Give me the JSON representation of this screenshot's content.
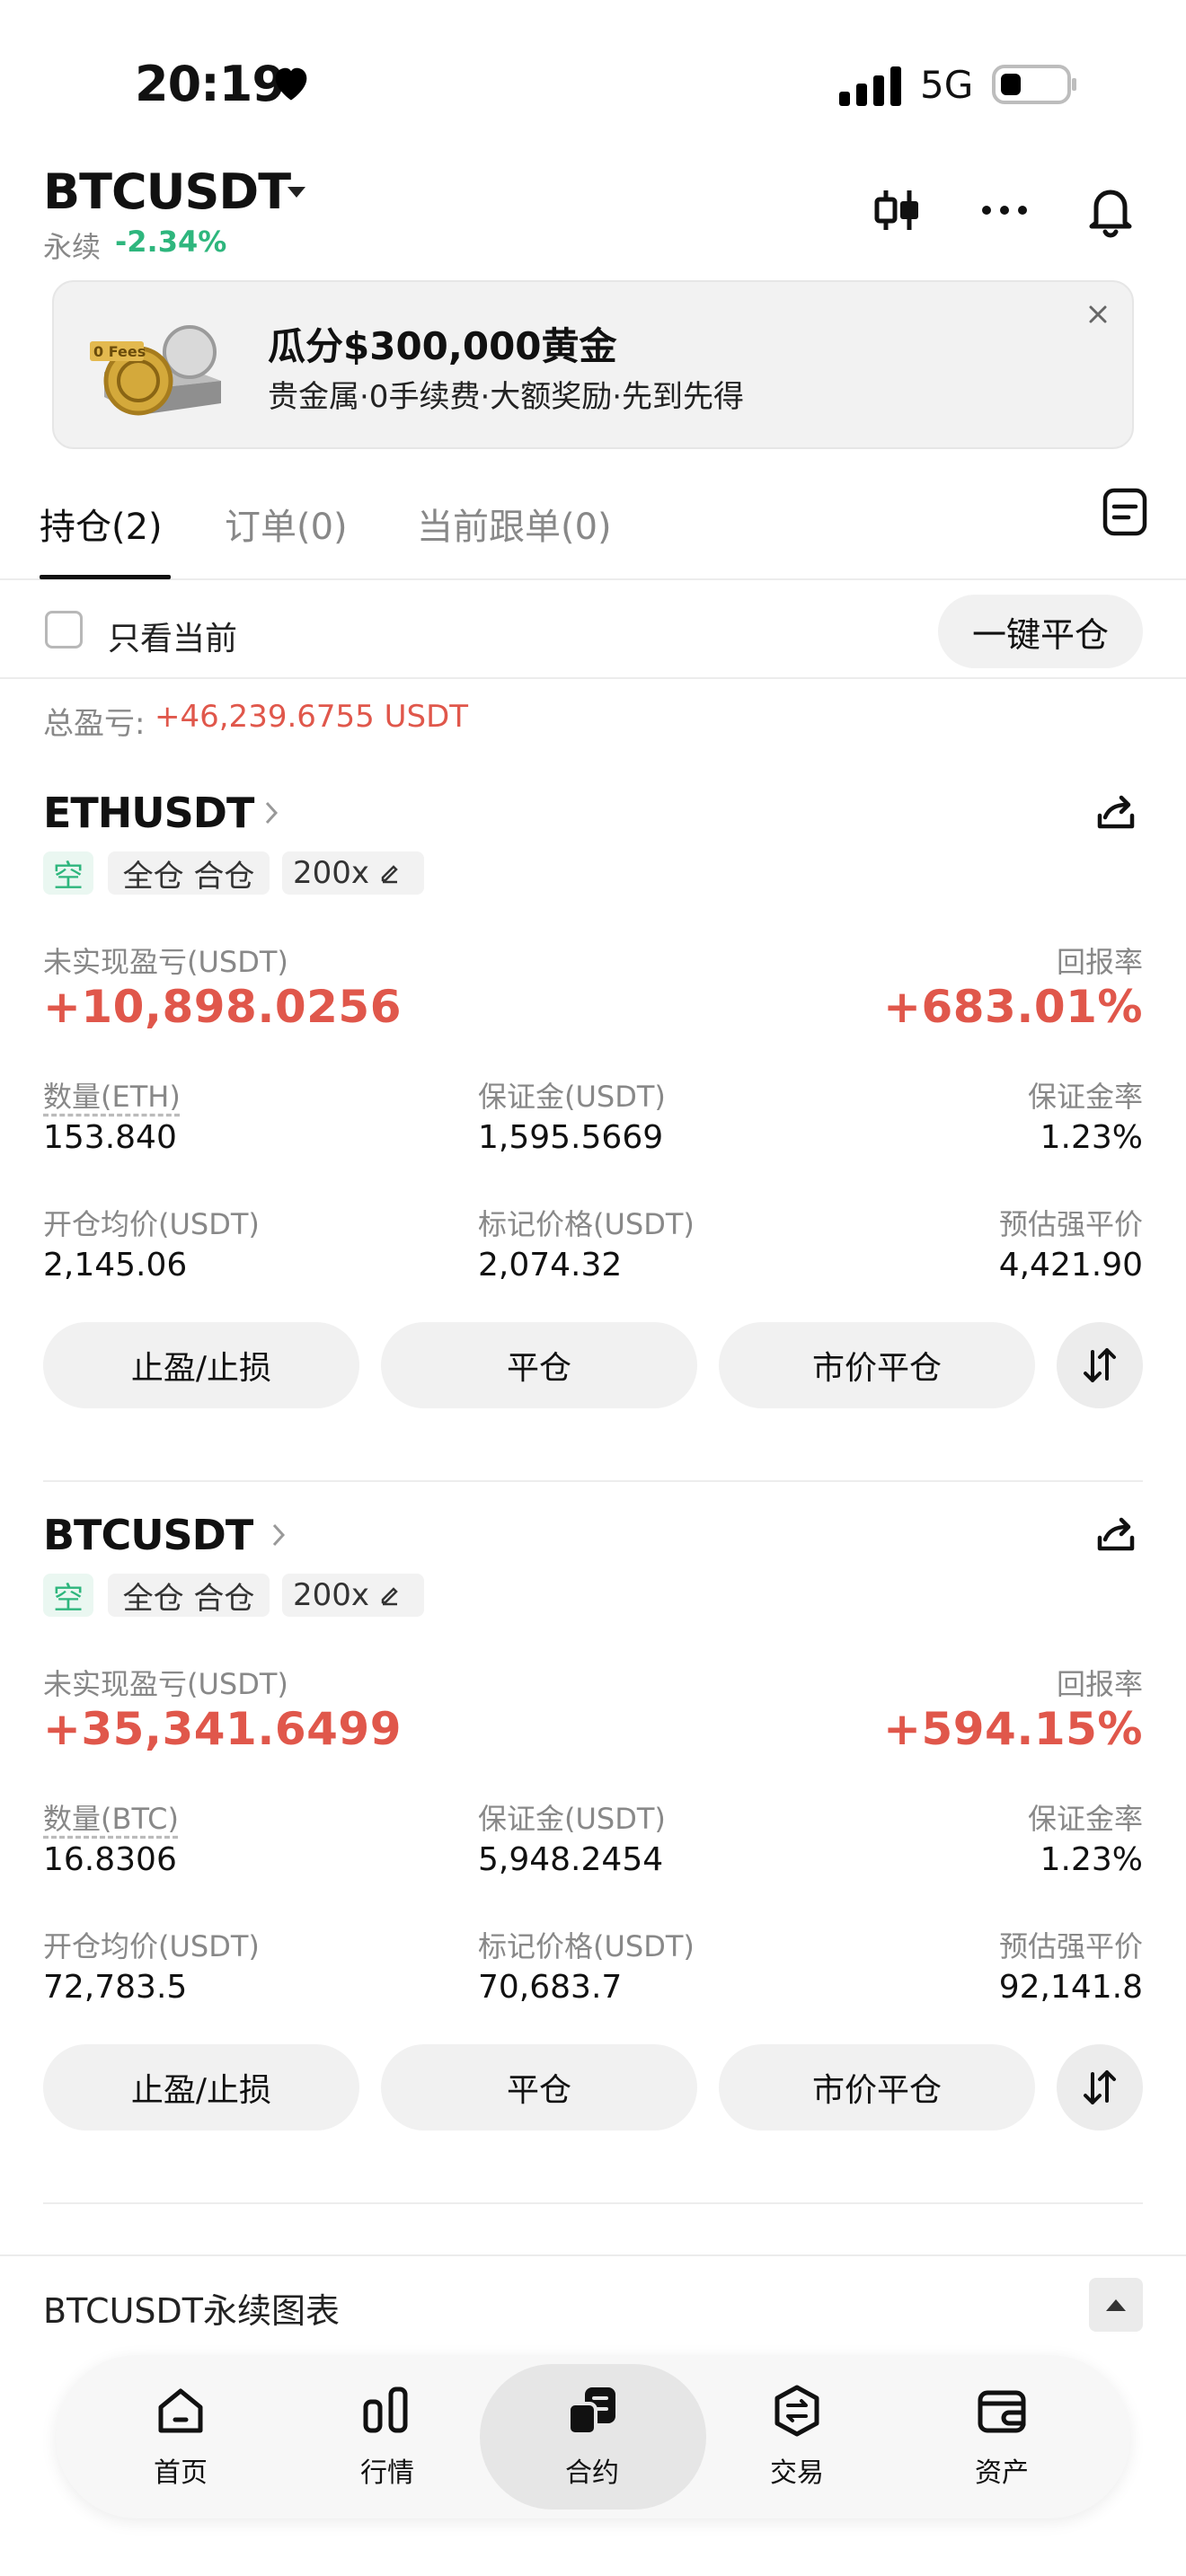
{
  "status_bar": {
    "time": "20:19",
    "network": "5G"
  },
  "header": {
    "pair": "BTCUSDT",
    "contract_type": "永续",
    "change": "-2.34%",
    "icons": [
      "candlestick-icon",
      "more-icon",
      "bell-icon"
    ]
  },
  "banner": {
    "title": "瓜分$300,000黄金",
    "subtitle": "贵金属·0手续费·大额奖励·先到先得",
    "image_text": "0 Fees"
  },
  "tabs": [
    {
      "label": "持仓(2)",
      "active": true
    },
    {
      "label": "订单(0)",
      "active": false
    },
    {
      "label": "当前跟单(0)",
      "active": false
    }
  ],
  "filter": {
    "only_current": "只看当前",
    "close_all": "一键平仓"
  },
  "summary": {
    "total_pnl_label": "总盈亏:",
    "total_pnl_value": "+46,239.6755 USDT"
  },
  "labels": {
    "unrealized_pnl": "未实现盈亏(USDT)",
    "roe": "回报率",
    "margin": "保证金(USDT)",
    "margin_ratio": "保证金率",
    "entry_price": "开仓均价(USDT)",
    "mark_price": "标记价格(USDT)",
    "liq_price": "预估强平价",
    "tp_sl": "止盈/止损",
    "close": "平仓",
    "market_close": "市价平仓"
  },
  "positions": [
    {
      "symbol": "ETHUSDT",
      "side": "空",
      "mode": "全仓 合仓",
      "leverage": "200x",
      "unrealized_pnl": "+10,898.0256",
      "roe": "+683.01%",
      "qty_label": "数量(ETH)",
      "qty": "153.840",
      "margin": "1,595.5669",
      "margin_ratio": "1.23%",
      "entry_price": "2,145.06",
      "mark_price": "2,074.32",
      "liq_price": "4,421.90"
    },
    {
      "symbol": "BTCUSDT",
      "side": "空",
      "mode": "全仓 合仓",
      "leverage": "200x",
      "unrealized_pnl": "+35,341.6499",
      "roe": "+594.15%",
      "qty_label": "数量(BTC)",
      "qty": "16.8306",
      "margin": "5,948.2454",
      "margin_ratio": "1.23%",
      "entry_price": "72,783.5",
      "mark_price": "70,683.7",
      "liq_price": "92,141.8"
    }
  ],
  "chart_bar": {
    "label": "BTCUSDT永续图表"
  },
  "bottom_nav": [
    {
      "label": "首页",
      "icon": "home-icon",
      "active": false
    },
    {
      "label": "行情",
      "icon": "market-icon",
      "active": false
    },
    {
      "label": "合约",
      "icon": "futures-icon",
      "active": true
    },
    {
      "label": "交易",
      "icon": "trade-icon",
      "active": false
    },
    {
      "label": "资产",
      "icon": "wallet-icon",
      "active": false
    }
  ],
  "colors": {
    "profit": "#e0574b",
    "short": "#2eb67d",
    "accent": "#111111"
  }
}
